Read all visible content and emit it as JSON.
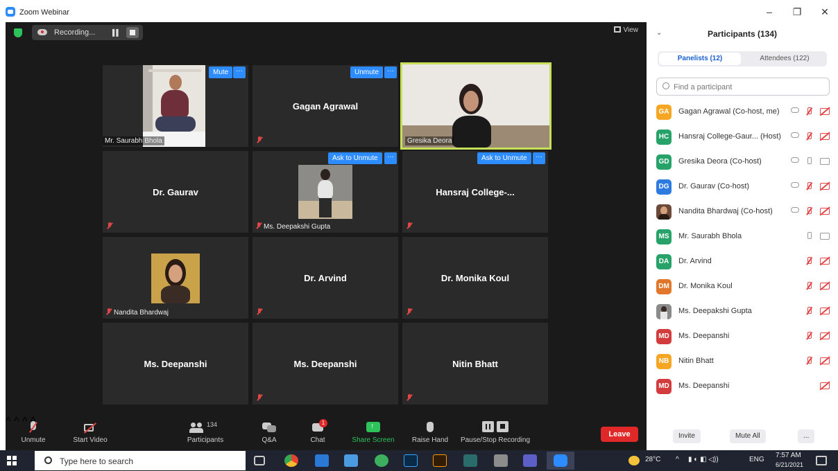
{
  "window": {
    "title": "Zoom Webinar"
  },
  "topbar": {
    "recording_label": "Recording...",
    "view_label": "View"
  },
  "tiles": {
    "saurabh": {
      "caption": "Mr. Saurabh Bhola",
      "btn": "Mute",
      "more": "···"
    },
    "gagan": {
      "name": "Gagan Agrawal",
      "btn": "Unmute",
      "more": "···"
    },
    "gresika": {
      "caption": "Gresika Deora"
    },
    "gaurav": {
      "name": "Dr. Gaurav"
    },
    "deepakshi": {
      "caption": "Ms. Deepakshi Gupta",
      "btn": "Ask to Unmute",
      "more": "···"
    },
    "hansraj": {
      "name": "Hansraj  College-...",
      "btn": "Ask to Unmute",
      "more": "···"
    },
    "nandita": {
      "caption": "Nandita Bhardwaj"
    },
    "arvind": {
      "name": "Dr. Arvind"
    },
    "monika": {
      "name": "Dr. Monika Koul"
    },
    "deepanshi1": {
      "name": "Ms. Deepanshi"
    },
    "deepanshi2": {
      "name": "Ms. Deepanshi"
    },
    "nitin": {
      "name": "Nitin Bhatt"
    }
  },
  "toolbar": {
    "unmute": "Unmute",
    "start_video": "Start Video",
    "participants": "Participants",
    "participants_count": "134",
    "qa": "Q&A",
    "chat": "Chat",
    "chat_badge": "1",
    "share": "Share Screen",
    "raise": "Raise Hand",
    "record": "Pause/Stop Recording",
    "leave": "Leave"
  },
  "panel": {
    "title": "Participants (134)",
    "tab_panelists": "Panelists (12)",
    "tab_attendees": "Attendees (122)",
    "search_placeholder": "Find a participant",
    "invite": "Invite",
    "mute_all": "Mute All",
    "more": "...",
    "people": [
      {
        "initials": "GA",
        "name": "Gagan Agrawal (Co-host, me)",
        "color": "#f5a623"
      },
      {
        "initials": "HC",
        "name": "Hansraj College-Gaur...  (Host)",
        "color": "#27a36a"
      },
      {
        "initials": "GD",
        "name": "Gresika Deora (Co-host)",
        "color": "#27a36a"
      },
      {
        "initials": "DG",
        "name": "Dr. Gaurav (Co-host)",
        "color": "#2d7be0"
      },
      {
        "initials": "",
        "name": "Nandita Bhardwaj (Co-host)",
        "color": "#6b4a3a"
      },
      {
        "initials": "MS",
        "name": "Mr. Saurabh Bhola",
        "color": "#27a36a"
      },
      {
        "initials": "DA",
        "name": "Dr. Arvind",
        "color": "#27a36a"
      },
      {
        "initials": "DM",
        "name": "Dr. Monika Koul",
        "color": "#e0772b"
      },
      {
        "initials": "",
        "name": "Ms. Deepakshi Gupta",
        "color": "#8a8a8a"
      },
      {
        "initials": "MD",
        "name": "Ms. Deepanshi",
        "color": "#d23c3c"
      },
      {
        "initials": "NB",
        "name": "Nitin Bhatt",
        "color": "#f5a623"
      },
      {
        "initials": "MD",
        "name": "Ms. Deepanshi",
        "color": "#d23c3c"
      }
    ]
  },
  "taskbar": {
    "search_placeholder": "Type here to search",
    "temp": "28°C",
    "lang": "ENG",
    "time": "7:57 AM",
    "date": "6/21/2021"
  }
}
